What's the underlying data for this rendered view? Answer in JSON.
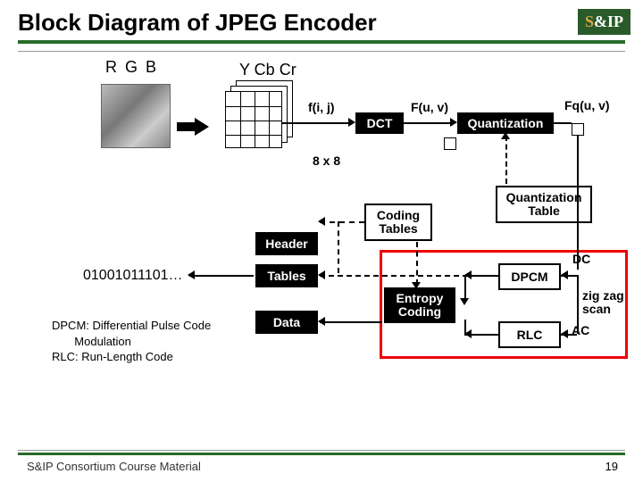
{
  "title": "Block Diagram of JPEG Encoder",
  "logo": {
    "prefix": "S",
    "amp": "&",
    "suffix": "IP"
  },
  "labels": {
    "rgb": "R G B",
    "ycbcr": "Y Cb Cr",
    "fij": "f(i, j)",
    "Fuv": "F(u, v)",
    "Fquv": "Fq(u, v)",
    "size": "8 x 8",
    "bitstream": "01001011101…",
    "dc": "DC",
    "ac": "AC",
    "zigzag": "zig zag scan",
    "dpcm_note": "DPCM: Differential Pulse Code\n       Modulation\nRLC: Run-Length Code"
  },
  "boxes": {
    "dct": "DCT",
    "quant": "Quantization",
    "qtable": "Quantization Table",
    "ctables": "Coding Tables",
    "header": "Header",
    "tables": "Tables",
    "data": "Data",
    "entropy": "Entropy Coding",
    "dpcm": "DPCM",
    "rlc": "RLC"
  },
  "footer": {
    "course": "S&IP Consortium Course Material",
    "page": "19"
  }
}
